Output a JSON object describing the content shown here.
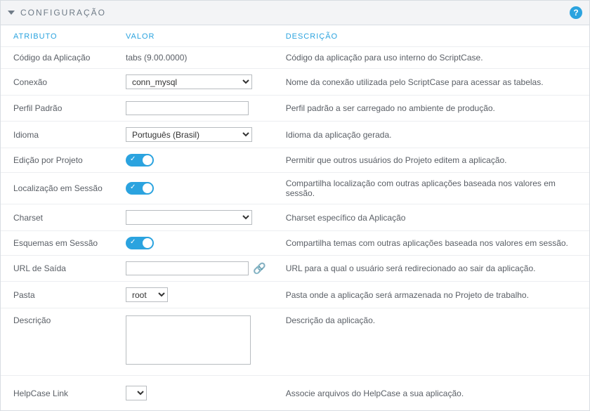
{
  "panel": {
    "title": "CONFIGURAÇÃO",
    "help_tooltip": "?"
  },
  "headers": {
    "attribute": "ATRIBUTO",
    "value": "VALOR",
    "description": "DESCRIÇÃO"
  },
  "rows": {
    "app_code": {
      "label": "Código da Aplicação",
      "value": "tabs (9.00.0000)",
      "desc": "Código da aplicação para uso interno do ScriptCase."
    },
    "connection": {
      "label": "Conexão",
      "value": "conn_mysql",
      "desc": "Nome da conexão utilizada pelo ScriptCase para acessar as tabelas."
    },
    "default_profile": {
      "label": "Perfil Padrão",
      "value": "",
      "desc": "Perfil padrão a ser carregado no ambiente de produção."
    },
    "language": {
      "label": "Idioma",
      "value": "Português (Brasil)",
      "desc": "Idioma da aplicação gerada."
    },
    "edit_by_project": {
      "label": "Edição por Projeto",
      "on": true,
      "desc": "Permitir que outros usuários do Projeto editem a aplicação."
    },
    "session_localization": {
      "label": "Localização em Sessão",
      "on": true,
      "desc": "Compartilha localização com outras aplicações baseada nos valores em sessão."
    },
    "charset": {
      "label": "Charset",
      "value": "",
      "desc": "Charset específico da Aplicação"
    },
    "session_themes": {
      "label": "Esquemas em Sessão",
      "on": true,
      "desc": "Compartilha temas com outras aplicações baseada nos valores em sessão."
    },
    "exit_url": {
      "label": "URL de Saída",
      "value": "",
      "desc": "URL para a qual o usuário será redirecionado ao sair da aplicação."
    },
    "folder": {
      "label": "Pasta",
      "value": "root",
      "desc": "Pasta onde a aplicação será armazenada no Projeto de trabalho."
    },
    "description": {
      "label": "Descrição",
      "value": "",
      "desc": "Descrição da aplicação."
    },
    "helpcase": {
      "label": "HelpCase Link",
      "value": "",
      "desc": "Associe arquivos do HelpCase a sua aplicação."
    }
  }
}
